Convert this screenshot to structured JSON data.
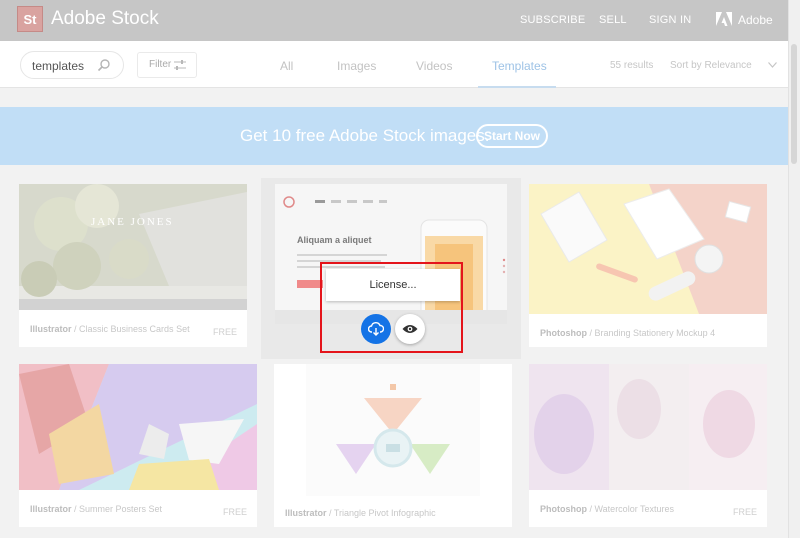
{
  "header": {
    "logo": "St",
    "brand": "Adobe Stock",
    "nav": [
      "SUBSCRIBE",
      "SELL",
      "SIGN IN"
    ],
    "adobe_label": "Adobe"
  },
  "search": {
    "value": "templates",
    "filter_label": "Filter"
  },
  "tabs": [
    {
      "label": "All",
      "active": false
    },
    {
      "label": "Images",
      "active": false
    },
    {
      "label": "Videos",
      "active": false
    },
    {
      "label": "Templates",
      "active": true
    }
  ],
  "results": "55 results",
  "sort": "Sort by Relevance",
  "banner": {
    "text": "Get 10 free Adobe Stock images.",
    "button": "Start Now"
  },
  "cards": [
    {
      "app": "Illustrator",
      "title": "Classic Business Cards Set",
      "price": "FREE",
      "overlay_text": "JANE JONES"
    },
    {
      "app": "",
      "title": "",
      "price": "",
      "overlay_text": "Aliquam a aliquet"
    },
    {
      "app": "Photoshop",
      "title": "Branding Stationery Mockup 4",
      "price": ""
    },
    {
      "app": "Illustrator",
      "title": "Summer Posters Set",
      "price": "FREE"
    },
    {
      "app": "Illustrator",
      "title": "Triangle Pivot Infographic",
      "price": ""
    },
    {
      "app": "Photoshop",
      "title": "Watercolor Textures",
      "price": "FREE"
    }
  ],
  "license_popup": {
    "label": "License..."
  },
  "colors": {
    "accent": "#1473e6",
    "highlight": "#e4141b",
    "banner": "#c1def6"
  }
}
